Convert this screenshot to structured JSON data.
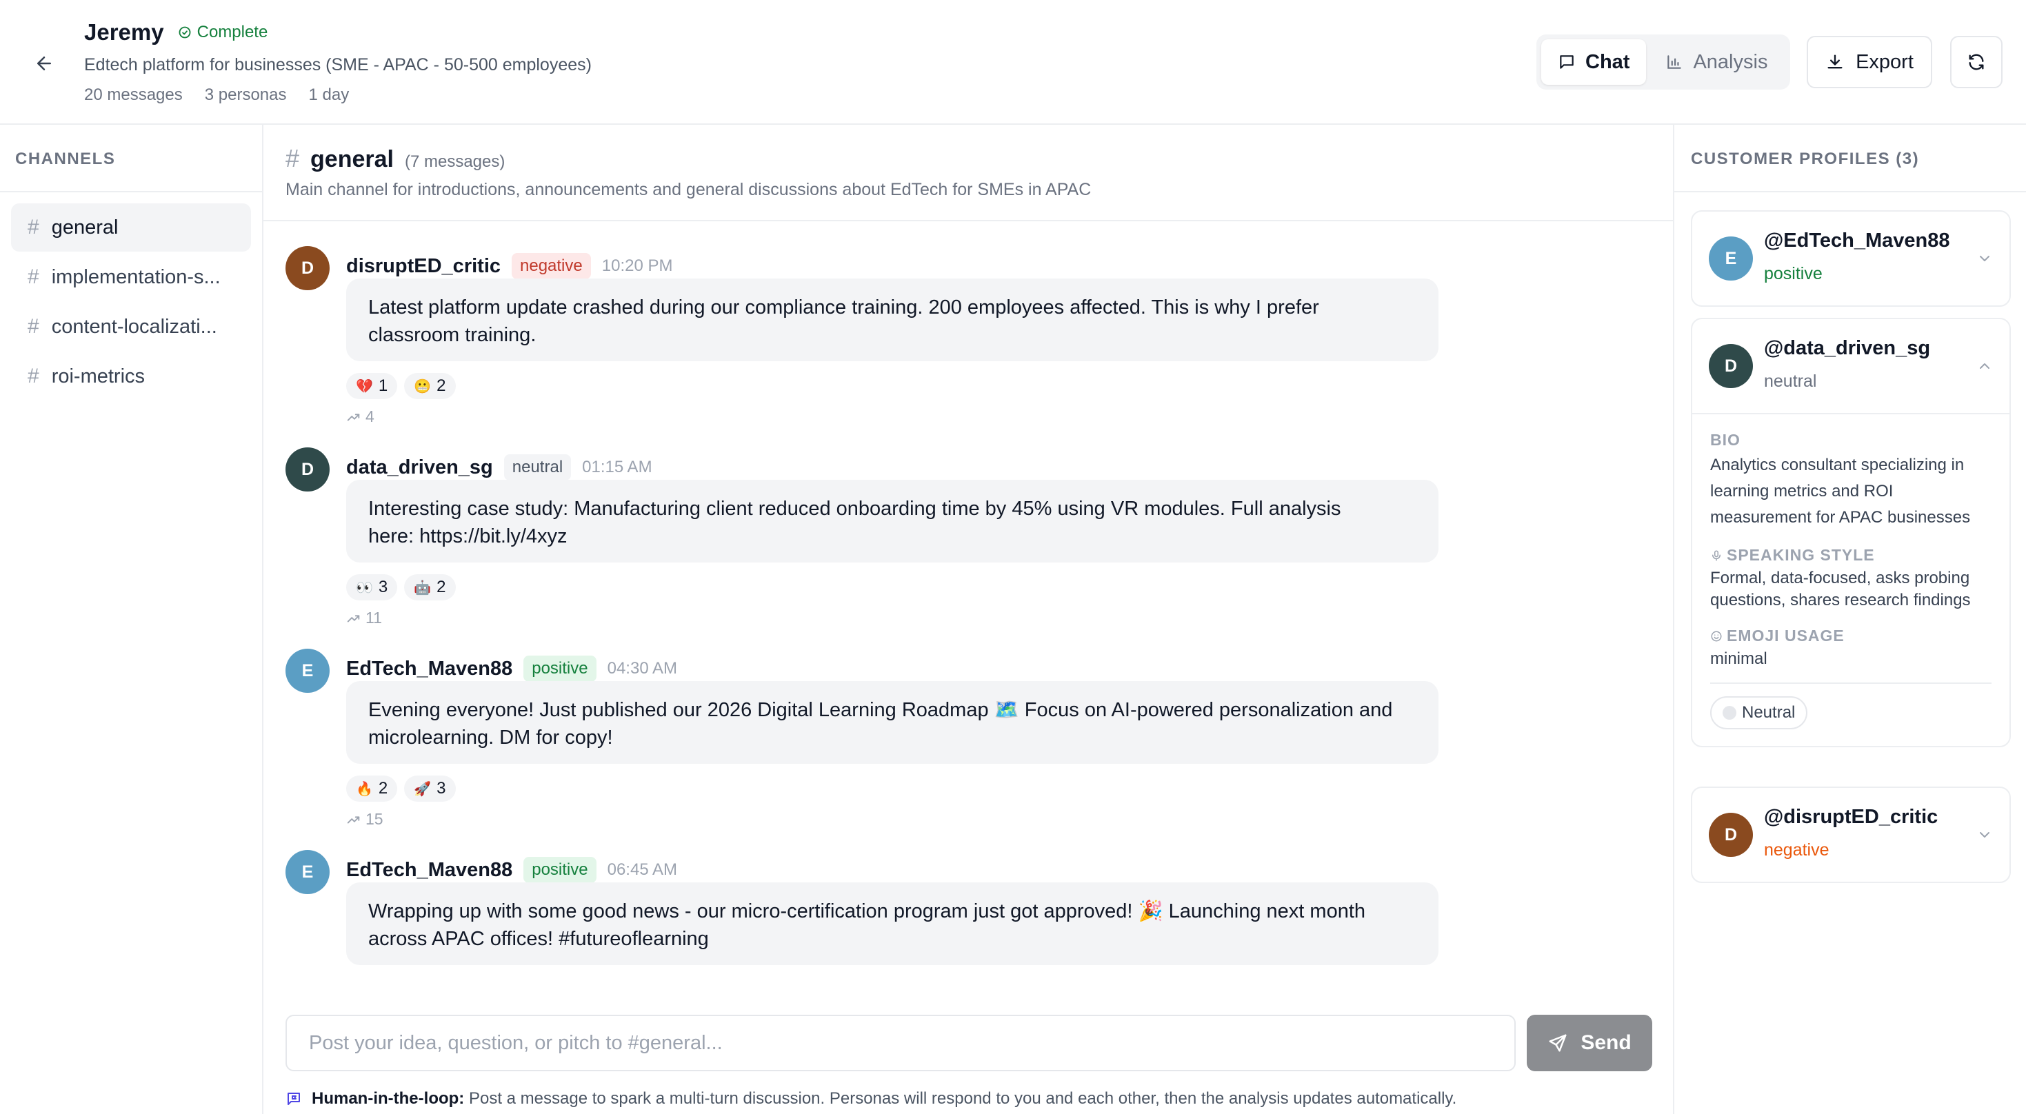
{
  "header": {
    "title": "Jeremy",
    "status": "Complete",
    "subtitle": "Edtech platform for businesses (SME - APAC - 50-500 employees)",
    "meta": [
      "20 messages",
      "3 personas",
      "1 day"
    ],
    "tabs": [
      {
        "label": "Chat",
        "active": true
      },
      {
        "label": "Analysis",
        "active": false
      }
    ],
    "export_label": "Export"
  },
  "sidebar": {
    "heading": "CHANNELS",
    "channels": [
      {
        "name": "general",
        "active": true
      },
      {
        "name": "implementation-s...",
        "active": false
      },
      {
        "name": "content-localizati...",
        "active": false
      },
      {
        "name": "roi-metrics",
        "active": false
      }
    ]
  },
  "channel": {
    "name": "general",
    "count": "(7 messages)",
    "description": "Main channel for introductions, announcements and general discussions about EdTech for SMEs in APAC"
  },
  "messages": [
    {
      "initial": "D",
      "avatar_color": "#8a4a1f",
      "author": "disruptED_critic",
      "sentiment": "negative",
      "time": "10:20 PM",
      "text_lines": [
        "Latest platform update crashed during our compliance training. 200 employees affected. This is why I prefer",
        "classroom training."
      ],
      "reactions": [
        {
          "emoji": "💔",
          "count": "1"
        },
        {
          "emoji": "😬",
          "count": "2"
        }
      ],
      "shares": "4"
    },
    {
      "initial": "D",
      "avatar_color": "#2f4a4a",
      "author": "data_driven_sg",
      "sentiment": "neutral",
      "time": "01:15 AM",
      "text_lines": [
        "Interesting case study: Manufacturing client reduced onboarding time by 45% using VR modules. Full analysis",
        "here: https://bit.ly/4xyz"
      ],
      "reactions": [
        {
          "emoji": "👀",
          "count": "3"
        },
        {
          "emoji": "🤖",
          "count": "2"
        }
      ],
      "shares": "11"
    },
    {
      "initial": "E",
      "avatar_color": "#5b9ec4",
      "author": "EdTech_Maven88",
      "sentiment": "positive",
      "time": "04:30 AM",
      "text_lines": [
        "Evening everyone! Just published our 2026 Digital Learning Roadmap 🗺️ Focus on AI-powered personalization and",
        "microlearning. DM for copy!"
      ],
      "reactions": [
        {
          "emoji": "🔥",
          "count": "2"
        },
        {
          "emoji": "🚀",
          "count": "3"
        }
      ],
      "shares": "15"
    },
    {
      "initial": "E",
      "avatar_color": "#5b9ec4",
      "author": "EdTech_Maven88",
      "sentiment": "positive",
      "time": "06:45 AM",
      "text_lines": [
        "Wrapping up with some good news - our micro-certification program just got approved! 🎉 Launching next month",
        "across APAC offices! #futureoflearning"
      ],
      "reactions": [],
      "shares": ""
    }
  ],
  "composer": {
    "placeholder": "Post your idea, question, or pitch to #general...",
    "send_label": "Send",
    "hint_bold": "Human-in-the-loop:",
    "hint_text": "Post a message to spark a multi-turn discussion. Personas will respond to you and each other, then the analysis updates automatically."
  },
  "profiles": {
    "heading": "CUSTOMER PROFILES (3)",
    "items": [
      {
        "initial": "E",
        "avatar_color": "#5b9ec4",
        "handle": "@EdTech_Maven88",
        "sentiment": "positive",
        "sentiment_color": "#15803d",
        "expanded": false
      },
      {
        "initial": "D",
        "avatar_color": "#2f4a4a",
        "handle": "@data_driven_sg",
        "sentiment": "neutral",
        "sentiment_color": "#6b7280",
        "expanded": true,
        "bio_label": "BIO",
        "bio_lines": [
          "Analytics consultant specializing in",
          "learning metrics and ROI",
          "measurement for APAC businesses"
        ],
        "style_label": "SPEAKING STYLE",
        "style_lines": [
          "Formal, data-focused, asks probing",
          "questions, shares research findings"
        ],
        "emoji_label": "EMOJI USAGE",
        "emoji_value": "minimal",
        "chip": "Neutral"
      },
      {
        "initial": "D",
        "avatar_color": "#8a4a1f",
        "handle": "@disruptED_critic",
        "sentiment": "negative",
        "sentiment_color": "#ea580c",
        "expanded": false
      }
    ]
  }
}
